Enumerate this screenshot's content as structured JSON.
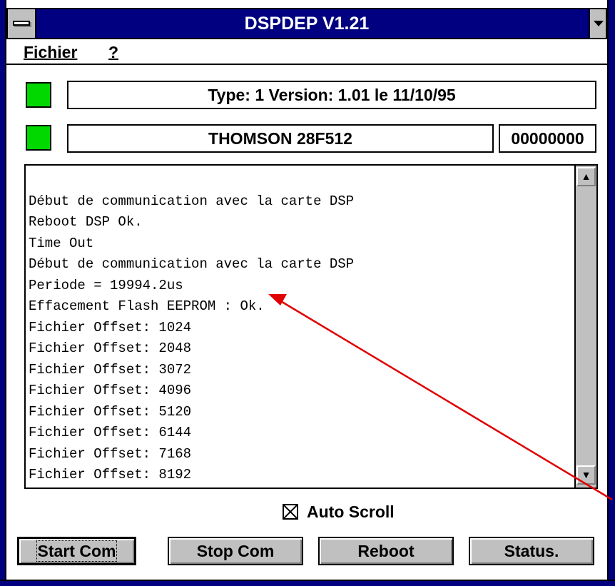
{
  "window": {
    "title": "DSPDEP V1.21"
  },
  "menu": {
    "items": [
      "Fichier",
      "?"
    ]
  },
  "status": {
    "type_line": "Type: 1 Version:  1.01 le 11/10/95",
    "device": "THOMSON 28F512",
    "counter": "00000000",
    "led_color": "#00d800"
  },
  "log": {
    "lines": [
      "Début de communication avec la carte DSP",
      "Reboot DSP Ok.",
      "Time Out",
      "Début de communication avec la carte DSP",
      "Periode = 19994.2us",
      "Effacement Flash EEPROM : Ok.",
      "Fichier Offset: 1024",
      "Fichier Offset: 2048",
      "Fichier Offset: 3072",
      "Fichier Offset: 4096",
      "Fichier Offset: 5120",
      "Fichier Offset: 6144",
      "Fichier Offset: 7168",
      "Fichier Offset: 8192"
    ]
  },
  "auto_scroll": {
    "label": "Auto Scroll",
    "checked": true
  },
  "buttons": {
    "start": "Start Com",
    "stop": "Stop Com",
    "reboot": "Reboot",
    "status": "Status."
  },
  "colors": {
    "titlebar": "#000080",
    "led": "#00d800",
    "annotation_arrow": "#e00000"
  }
}
